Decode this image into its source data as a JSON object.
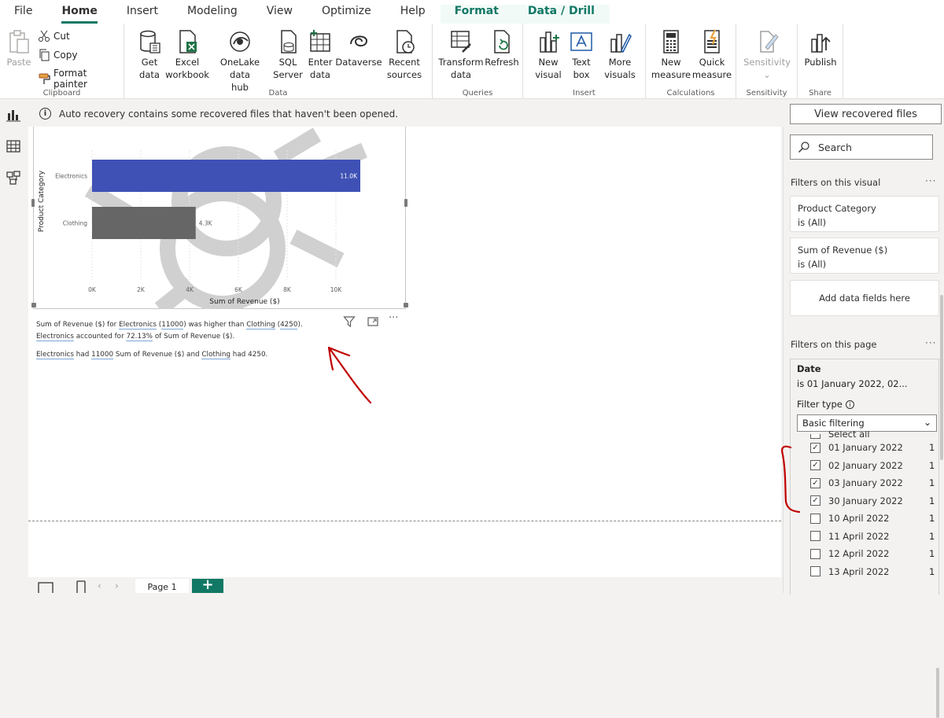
{
  "menu": [
    "File",
    "Home",
    "Insert",
    "Modeling",
    "View",
    "Optimize",
    "Help",
    "Format",
    "Data / Drill"
  ],
  "ribbon": {
    "clipboard": {
      "paste": "Paste",
      "cut": "Cut",
      "copy": "Copy",
      "format_painter": "Format painter",
      "group": "Clipboard"
    },
    "data": {
      "get_data": [
        "Get",
        "data"
      ],
      "excel": [
        "Excel",
        "workbook"
      ],
      "onelake": [
        "OneLake data",
        "hub"
      ],
      "sql": [
        "SQL",
        "Server"
      ],
      "enter": [
        "Enter",
        "data"
      ],
      "dataverse": [
        "Dataverse",
        ""
      ],
      "recent": [
        "Recent",
        "sources"
      ],
      "group": "Data"
    },
    "queries": {
      "transform": [
        "Transform",
        "data"
      ],
      "refresh": [
        "Refresh",
        ""
      ],
      "group": "Queries"
    },
    "insert": {
      "new_visual": [
        "New",
        "visual"
      ],
      "text_box": [
        "Text",
        "box"
      ],
      "more_visuals": [
        "More",
        "visuals"
      ],
      "group": "Insert"
    },
    "calculations": {
      "new_measure": [
        "New",
        "measure"
      ],
      "quick_measure": [
        "Quick",
        "measure"
      ],
      "group": "Calculations"
    },
    "sensitivity": {
      "label": "Sensitivity",
      "group": "Sensitivity"
    },
    "share": {
      "publish": "Publish",
      "group": "Share"
    }
  },
  "notification": {
    "text": "Auto recovery contains some recovered files that haven't been opened.",
    "button": "View recovered files"
  },
  "chart_data": {
    "type": "bar",
    "orientation": "horizontal",
    "categories": [
      "Electronics",
      "Clothing"
    ],
    "values": [
      11000,
      4250
    ],
    "data_labels": [
      "11.0K",
      "4.3K"
    ],
    "colors": [
      "#3f51b5",
      "#666666"
    ],
    "xlabel": "Sum of Revenue ($)",
    "ylabel": "Product Category",
    "xticks": [
      "0K",
      "2K",
      "4K",
      "6K",
      "8K",
      "10K"
    ],
    "xlim": [
      0,
      12000
    ]
  },
  "narrative": {
    "l1": {
      "a": "Sum of Revenue ($) for ",
      "b": "Electronics",
      "c": " (",
      "d": "11000",
      "e": ") was higher than ",
      "f": "Clothing",
      "g": " (",
      "h": "4250",
      "i": ")."
    },
    "l2": {
      "a": "Electronics",
      "b": " accounted for ",
      "c": "72.13%",
      "d": " of Sum of Revenue ($)."
    },
    "l3": {
      "a": "Electronics",
      "b": " had ",
      "c": "11000",
      "d": " Sum of Revenue ($) and ",
      "e": "Clothing",
      "f": " had 4250."
    }
  },
  "filters": {
    "search": "Search",
    "visual_label": "Filters on this visual",
    "cards": [
      {
        "title": "Product Category",
        "sub": "is (All)"
      },
      {
        "title": "Sum of Revenue ($)",
        "sub": "is (All)"
      }
    ],
    "add_fields": "Add data fields here",
    "page_label": "Filters on this page",
    "date": {
      "title": "Date",
      "sub": "is 01 January 2022, 02...",
      "filter_type": "Filter type",
      "mode": "Basic filtering",
      "select_all": "Select all",
      "options": [
        {
          "label": "01 January 2022",
          "count": "1",
          "checked": true
        },
        {
          "label": "02 January 2022",
          "count": "1",
          "checked": true
        },
        {
          "label": "03 January 2022",
          "count": "1",
          "checked": true
        },
        {
          "label": "30 January 2022",
          "count": "1",
          "checked": true
        },
        {
          "label": "10 April 2022",
          "count": "1",
          "checked": false
        },
        {
          "label": "11 April 2022",
          "count": "1",
          "checked": false
        },
        {
          "label": "12 April 2022",
          "count": "1",
          "checked": false
        },
        {
          "label": "13 April 2022",
          "count": "1",
          "checked": false
        }
      ]
    }
  },
  "pages": {
    "tab": "Page 1",
    "add": "+"
  }
}
